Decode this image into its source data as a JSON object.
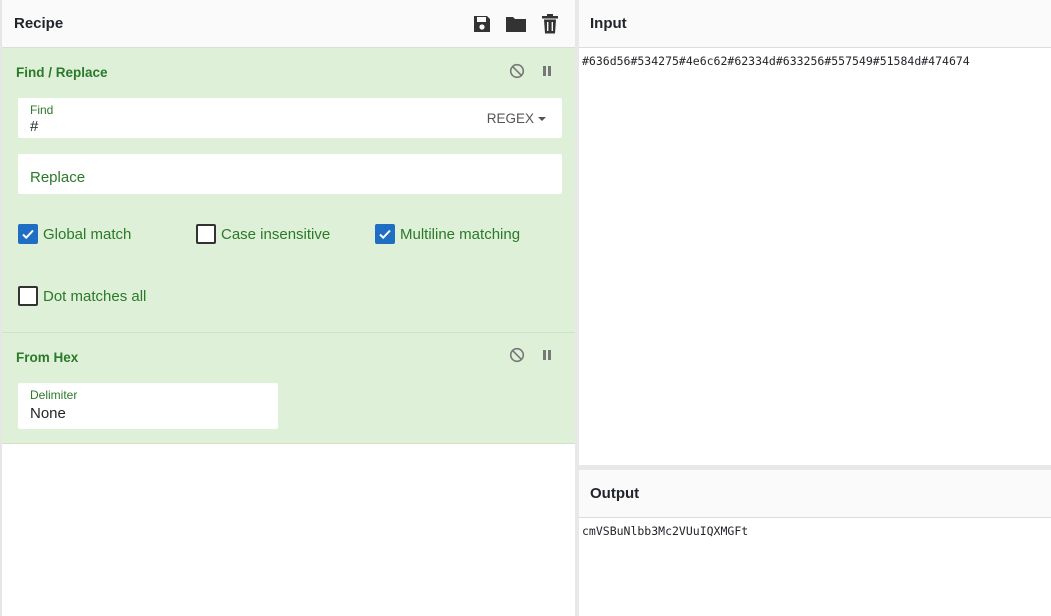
{
  "recipe": {
    "title": "Recipe",
    "header_icons": [
      "save-icon",
      "folder-icon",
      "trash-icon"
    ]
  },
  "operations": [
    {
      "title": "Find / Replace",
      "find": {
        "label": "Find",
        "value": "#",
        "mode": "REGEX"
      },
      "replace": {
        "placeholder": "Replace"
      },
      "checkboxes": [
        {
          "label": "Global match",
          "checked": true
        },
        {
          "label": "Case insensitive",
          "checked": false
        },
        {
          "label": "Multiline matching",
          "checked": true
        },
        {
          "label": "Dot matches all",
          "checked": false
        }
      ]
    },
    {
      "title": "From Hex",
      "delimiter": {
        "label": "Delimiter",
        "value": "None"
      }
    }
  ],
  "input": {
    "title": "Input",
    "text": "#636d56#534275#4e6c62#62334d#633256#557549#51584d#474674"
  },
  "output": {
    "title": "Output",
    "text": "cmVSBuNlbb3Mc2VUuIQXMGFt"
  },
  "colors": {
    "operation_bg": "#dff0d8",
    "operation_title": "#2a7a2a",
    "checkbox_checked": "#1e6fc4"
  }
}
